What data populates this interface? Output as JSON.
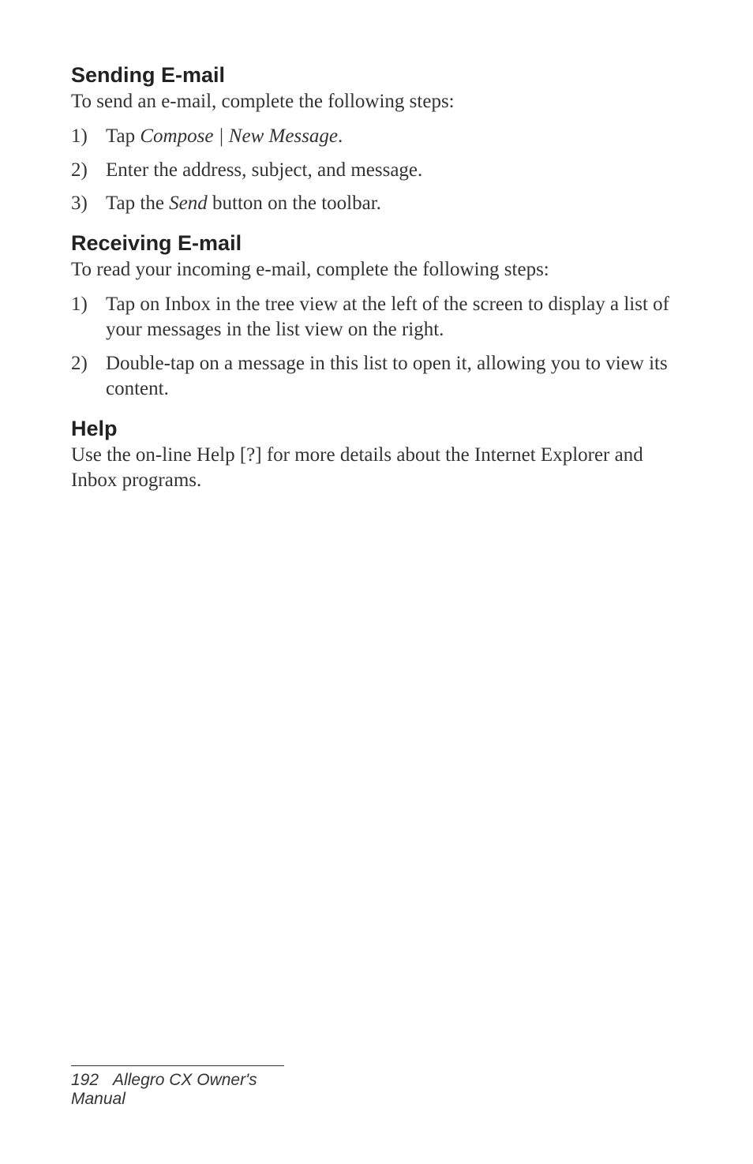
{
  "sections": {
    "sending": {
      "heading": "Sending E-mail",
      "intro": "To send an e-mail, complete the following steps:",
      "steps": {
        "s1": {
          "num": "1)",
          "pre": "Tap ",
          "italic": "Compose | New Message",
          "post": "."
        },
        "s2": {
          "num": "2)",
          "text": "Enter the address, subject, and message."
        },
        "s3": {
          "num": "3)",
          "pre": "Tap the ",
          "italic": "Send",
          "post": " button on the toolbar."
        }
      }
    },
    "receiving": {
      "heading": "Receiving E-mail",
      "intro": "To read your incoming e-mail, complete the following steps:",
      "steps": {
        "s1": {
          "num": "1)",
          "text": "Tap on Inbox in the tree view at the left of the screen to display a list of your messages in the list view on the right."
        },
        "s2": {
          "num": "2)",
          "text": "Double-tap on a message in this list to open it, allowing you to view its content."
        }
      }
    },
    "help": {
      "heading": "Help",
      "body": "Use the on-line Help [?] for more details about the Internet Explorer and Inbox programs."
    }
  },
  "footer": {
    "page": "192",
    "title": "Allegro CX Owner's Manual"
  }
}
